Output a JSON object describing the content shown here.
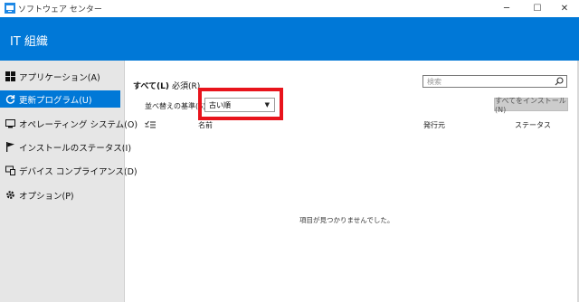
{
  "window": {
    "title": "ソフトウェア センター",
    "minimize": "─",
    "maximize": "☐",
    "close": "✕"
  },
  "header": {
    "title": "IT 組織"
  },
  "sidebar": {
    "items": [
      {
        "label": "アプリケーション(A)",
        "icon": "apps-icon"
      },
      {
        "label": "更新プログラム(U)",
        "icon": "refresh-icon",
        "active": true
      },
      {
        "label": "オペレーティング システム(O)",
        "icon": "os-icon"
      },
      {
        "label": "インストールのステータス(I)",
        "icon": "flag-icon"
      },
      {
        "label": "デバイス コンプライアンス(D)",
        "icon": "device-icon"
      },
      {
        "label": "オプション(P)",
        "icon": "gear-icon"
      }
    ]
  },
  "main": {
    "tabs": [
      {
        "label": "すべて(L)",
        "selected": true
      },
      {
        "label": "必須(R)",
        "selected": false
      }
    ],
    "sort": {
      "label": "並べ替えの基準(S):",
      "value": "古い順"
    },
    "search": {
      "placeholder": "検索"
    },
    "install_all": "すべてをインストール(N)",
    "columns": {
      "name": "名前",
      "publisher": "発行元",
      "status": "ステータス"
    },
    "empty_message": "項目が見つかりませんでした。"
  },
  "colors": {
    "accent": "#0078d7",
    "highlight": "#e8141c",
    "sidebar_bg": "#e6e6e6"
  }
}
